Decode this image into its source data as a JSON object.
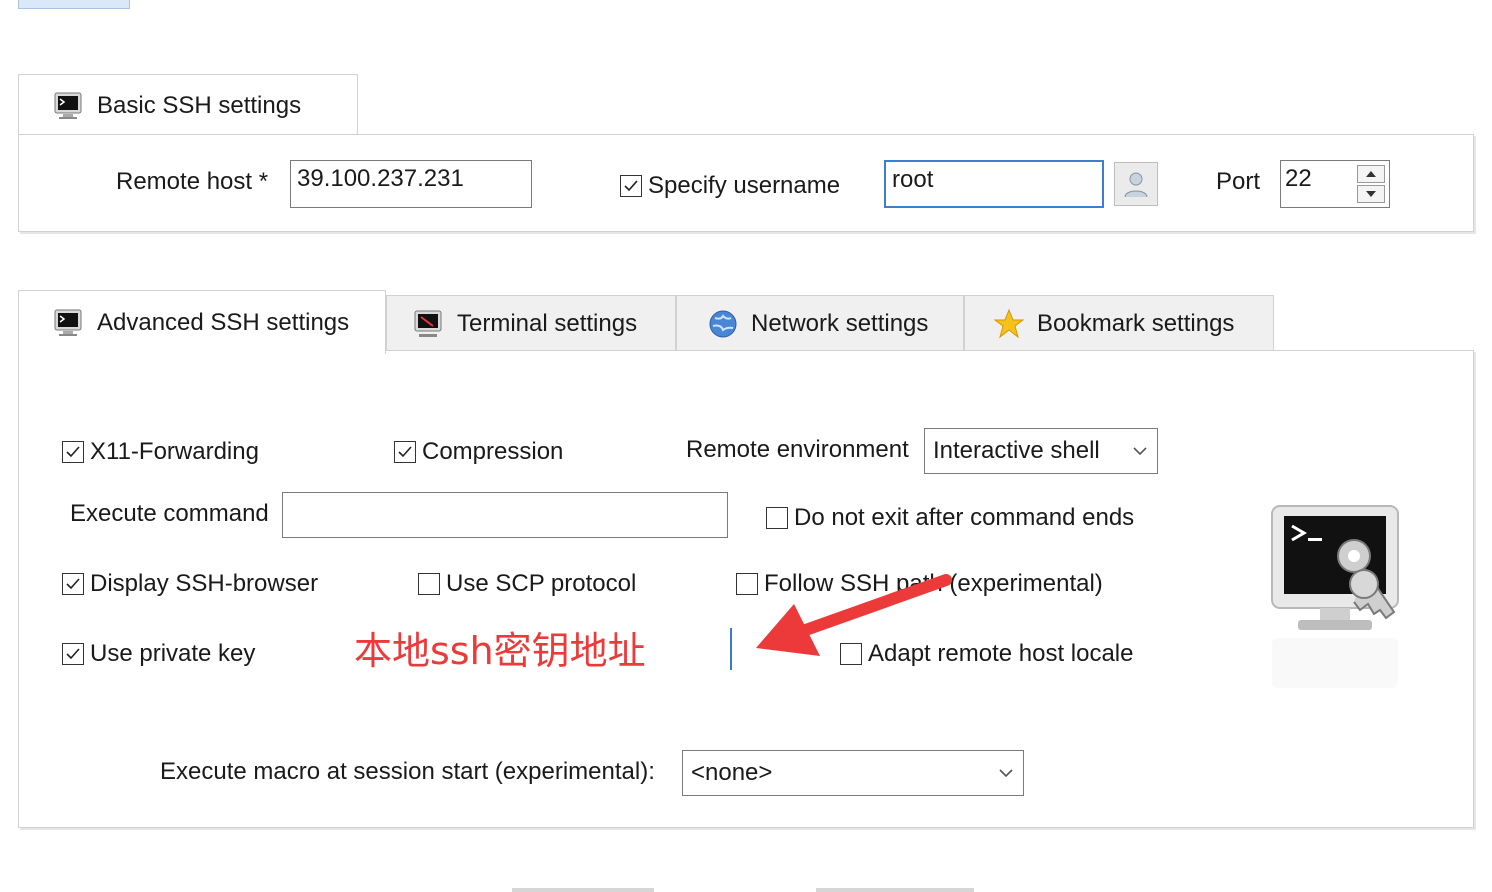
{
  "basic_tab": {
    "label": "Basic SSH settings",
    "icon": "terminal-icon"
  },
  "basic": {
    "remote_host_label": "Remote host *",
    "remote_host_value": "39.100.237.231",
    "specify_username_label": "Specify username",
    "specify_username_checked": true,
    "username_value": "root",
    "port_label": "Port",
    "port_value": "22"
  },
  "tabs": [
    {
      "label": "Advanced SSH settings",
      "icon": "terminal-icon",
      "active": true
    },
    {
      "label": "Terminal settings",
      "icon": "terminal-settings-icon",
      "active": false
    },
    {
      "label": "Network settings",
      "icon": "globe-icon",
      "active": false
    },
    {
      "label": "Bookmark settings",
      "icon": "star-icon",
      "active": false
    }
  ],
  "advanced": {
    "x11_forwarding": {
      "label": "X11-Forwarding",
      "checked": true
    },
    "compression": {
      "label": "Compression",
      "checked": true
    },
    "remote_environment_label": "Remote environment",
    "remote_environment_value": "Interactive shell",
    "execute_command_label": "Execute command",
    "execute_command_value": "",
    "do_not_exit": {
      "label": "Do not exit after command ends",
      "checked": false
    },
    "display_ssh_browser": {
      "label": "Display SSH-browser",
      "checked": true
    },
    "use_scp_protocol": {
      "label": "Use SCP protocol",
      "checked": false
    },
    "follow_ssh_path": {
      "label": "Follow SSH path (experimental)",
      "checked": false
    },
    "use_private_key": {
      "label": "Use private key",
      "checked": true
    },
    "adapt_remote_host_locale": {
      "label": "Adapt remote host locale",
      "checked": false
    },
    "macro_label": "Execute macro at session start (experimental):",
    "macro_value": "<none>"
  },
  "annotation": {
    "text": "本地ssh密钥地址",
    "color": "#ec3a3a"
  },
  "colors": {
    "focus_border": "#3c7fd1",
    "annotation_red": "#ec3a3a"
  }
}
